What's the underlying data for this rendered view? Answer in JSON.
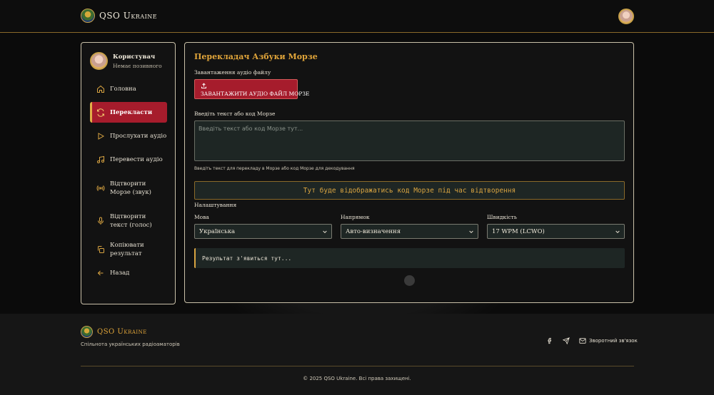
{
  "header": {
    "brand": "QSO Ukraine"
  },
  "sidebar": {
    "user_name": "Користувач",
    "user_callsign": "Немає позивного",
    "items": [
      {
        "label": "Головна",
        "icon": "home-icon"
      },
      {
        "label": "Перекласти",
        "icon": "refresh-icon",
        "active": true
      },
      {
        "label": "Прослухати аудіо",
        "icon": "play-icon"
      },
      {
        "label": "Перевести аудіо",
        "icon": "music-note-icon"
      },
      {
        "label": "Відтворити Морзе (звук)",
        "icon": "broadcast-icon"
      },
      {
        "label": "Відтворити текст (голос)",
        "icon": "microphone-icon"
      },
      {
        "label": "Копіювати результат",
        "icon": "copy-icon"
      },
      {
        "label": "Назад",
        "icon": "arrow-left-icon"
      }
    ]
  },
  "main": {
    "title": "Перекладач Азбуки Морзе",
    "upload_label": "Завантаження аудіо файлу",
    "upload_button": "ЗАВАНТАЖИТИ АУДІО ФАЙЛ МОРЗЕ",
    "input_label": "Введіть текст або код Морзе",
    "input_placeholder": "Введіть текст або код Морзе тут...",
    "input_hint": "Введіть текст для перекладу в Морзе або код Морзе для декодування",
    "morse_display": "Тут буде відображатись код Морзе під час відтворення",
    "settings_label": "Налаштування",
    "language_label": "Мова",
    "language_value": "Українська",
    "direction_label": "Напрямок",
    "direction_value": "Авто-визначення",
    "speed_label": "Швидкість",
    "speed_value": "17 WPM (LCWO)",
    "result_placeholder": "Результат з'явиться тут..."
  },
  "footer": {
    "brand": "QSO Ukraine",
    "tagline": "Спільнота українських радіоаматорів",
    "contact": "Зворотний зв'язок",
    "copyright": "© 2025 QSO Ukraine. Всі права захищені."
  },
  "colors": {
    "accent": "#e2a63a",
    "active": "#a61c2c",
    "background": "#0b0b0b"
  }
}
